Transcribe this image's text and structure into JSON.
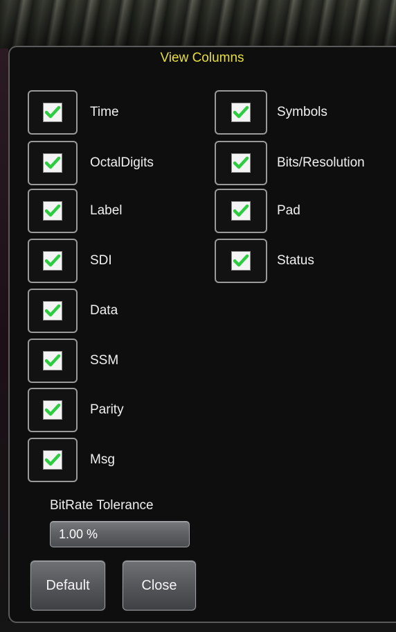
{
  "dialog": {
    "title": "View Columns"
  },
  "columns": {
    "left": [
      {
        "label": "Time",
        "checked": true
      },
      {
        "label": "OctalDigits",
        "checked": true
      },
      {
        "label": "Label",
        "checked": true
      },
      {
        "label": "SDI",
        "checked": true
      },
      {
        "label": "Data",
        "checked": true
      },
      {
        "label": "SSM",
        "checked": true
      },
      {
        "label": "Parity",
        "checked": true
      },
      {
        "label": "Msg",
        "checked": true
      }
    ],
    "right": [
      {
        "label": "Symbols",
        "checked": true
      },
      {
        "label": "Bits/Resolution",
        "checked": true
      },
      {
        "label": "Pad",
        "checked": true
      },
      {
        "label": "Status",
        "checked": true
      }
    ]
  },
  "tolerance": {
    "label": "BitRate Tolerance",
    "value": "1.00 %"
  },
  "buttons": {
    "default_label": "Default",
    "close_label": "Close"
  },
  "colors": {
    "title": "#e8df3a",
    "checkmark": "#2ecc40"
  }
}
